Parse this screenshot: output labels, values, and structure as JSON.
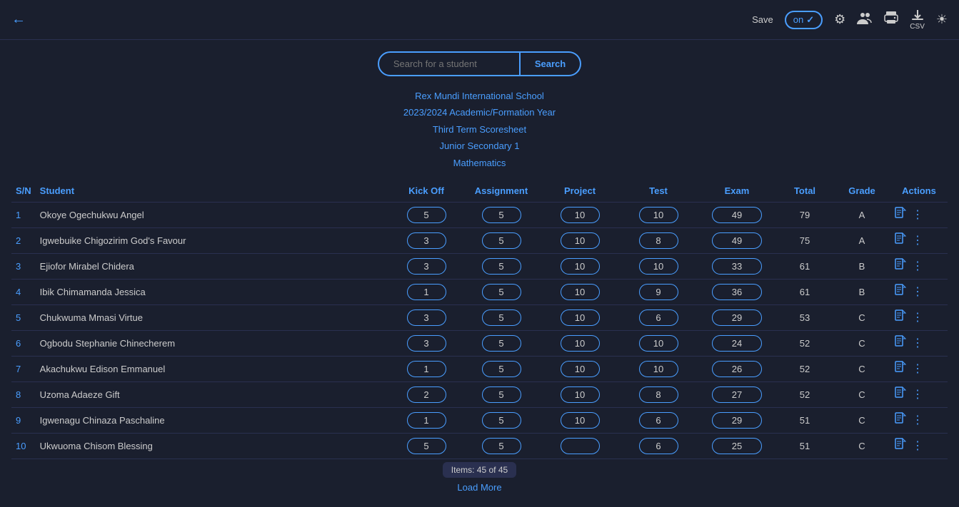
{
  "toolbar": {
    "back_icon": "←",
    "save_label": "Save",
    "toggle_label": "on",
    "toggle_check": "✓",
    "icons": {
      "settings": "⚙",
      "people": "⠿",
      "print": "🖨",
      "csv_download": "↓",
      "csv_text": "CSV",
      "brightness": "☀"
    }
  },
  "search": {
    "placeholder": "Search for a student",
    "button_label": "Search"
  },
  "school_info": {
    "name": "Rex Mundi International School",
    "year": "2023/2024 Academic/Formation Year",
    "term": "Third Term Scoresheet",
    "class": "Junior Secondary 1",
    "subject": "Mathematics"
  },
  "table": {
    "headers": {
      "sn": "S/N",
      "student": "Student",
      "kickoff": "Kick Off",
      "assignment": "Assignment",
      "project": "Project",
      "test": "Test",
      "exam": "Exam",
      "total": "Total",
      "grade": "Grade",
      "actions": "Actions"
    },
    "rows": [
      {
        "sn": "1",
        "name": "Okoye Ogechukwu Angel",
        "kickoff": "5",
        "assignment": "5",
        "project": "10",
        "test": "10",
        "exam": "49",
        "total": "79",
        "grade": "A"
      },
      {
        "sn": "2",
        "name": "Igwebuike Chigozirim God's Favour",
        "kickoff": "3",
        "assignment": "5",
        "project": "10",
        "test": "8",
        "exam": "49",
        "total": "75",
        "grade": "A"
      },
      {
        "sn": "3",
        "name": "Ejiofor Mirabel Chidera",
        "kickoff": "3",
        "assignment": "5",
        "project": "10",
        "test": "10",
        "exam": "33",
        "total": "61",
        "grade": "B"
      },
      {
        "sn": "4",
        "name": "Ibik Chimamanda Jessica",
        "kickoff": "1",
        "assignment": "5",
        "project": "10",
        "test": "9",
        "exam": "36",
        "total": "61",
        "grade": "B"
      },
      {
        "sn": "5",
        "name": "Chukwuma Mmasi Virtue",
        "kickoff": "3",
        "assignment": "5",
        "project": "10",
        "test": "6",
        "exam": "29",
        "total": "53",
        "grade": "C"
      },
      {
        "sn": "6",
        "name": "Ogbodu Stephanie Chinecherem",
        "kickoff": "3",
        "assignment": "5",
        "project": "10",
        "test": "10",
        "exam": "24",
        "total": "52",
        "grade": "C"
      },
      {
        "sn": "7",
        "name": "Akachukwu Edison Emmanuel",
        "kickoff": "1",
        "assignment": "5",
        "project": "10",
        "test": "10",
        "exam": "26",
        "total": "52",
        "grade": "C"
      },
      {
        "sn": "8",
        "name": "Uzoma Adaeze Gift",
        "kickoff": "2",
        "assignment": "5",
        "project": "10",
        "test": "8",
        "exam": "27",
        "total": "52",
        "grade": "C"
      },
      {
        "sn": "9",
        "name": "Igwenagu Chinaza Paschaline",
        "kickoff": "1",
        "assignment": "5",
        "project": "10",
        "test": "6",
        "exam": "29",
        "total": "51",
        "grade": "C"
      },
      {
        "sn": "10",
        "name": "Ukwuoma Chisom Blessing",
        "kickoff": "5",
        "assignment": "5",
        "project": "",
        "test": "6",
        "exam": "25",
        "total": "51",
        "grade": "C"
      }
    ]
  },
  "pagination": {
    "items_text": "Items: 45 of 45",
    "load_more": "Load More"
  }
}
